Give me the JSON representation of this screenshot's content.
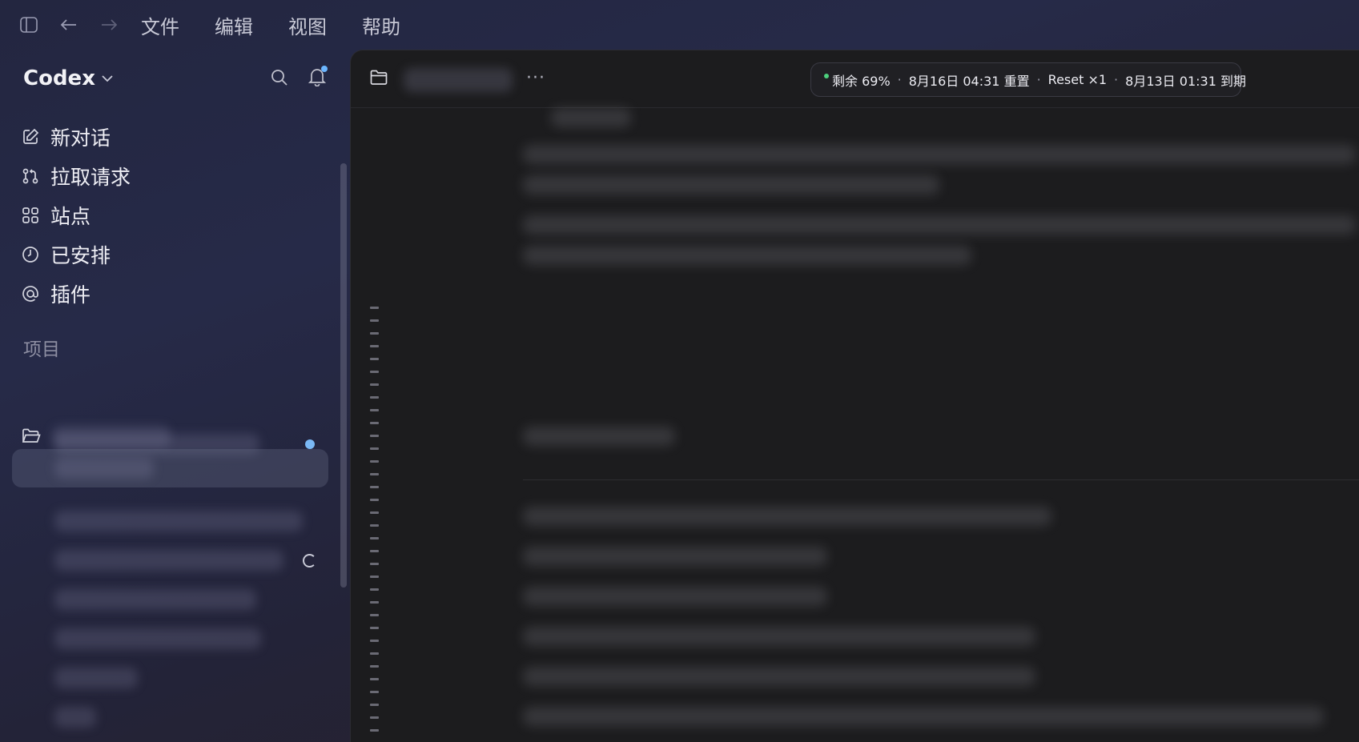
{
  "menubar": {
    "items": [
      "文件",
      "编辑",
      "视图",
      "帮助"
    ]
  },
  "icons": {
    "sidebar_toggle": "sidebar-toggle-icon",
    "back": "arrow-left-icon",
    "forward": "arrow-right-icon",
    "search": "search-icon",
    "bell": "bell-icon",
    "new_chat": "edit-icon",
    "pull_request": "pull-request-icon",
    "sites": "grid-icon",
    "scheduled": "clock-icon",
    "plugins": "at-icon",
    "folder": "folder-icon"
  },
  "sidebar": {
    "brand": "Codex",
    "nav": [
      {
        "label": "新对话"
      },
      {
        "label": "拉取请求"
      },
      {
        "label": "站点"
      },
      {
        "label": "已安排"
      },
      {
        "label": "插件"
      }
    ],
    "section_title": "项目"
  },
  "main": {
    "more_label": "···",
    "usage": {
      "remaining": "剩余 69%",
      "reset_time": "8月16日 04:31 重置",
      "reset_count": "Reset ×1",
      "expire": "8月13日 01:31 到期",
      "separator": "·"
    }
  },
  "colors": {
    "accent_blue": "#7ab8f5",
    "status_green": "#4cd07d",
    "main_bg": "#1c1c1e"
  }
}
